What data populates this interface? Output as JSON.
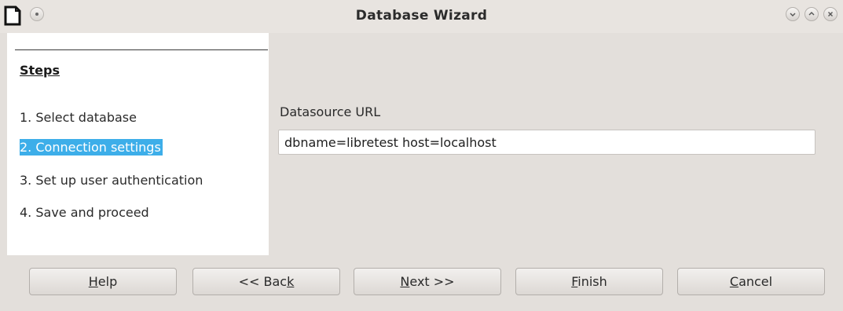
{
  "window": {
    "title": "Database Wizard",
    "app_icon": "document-icon",
    "controls": [
      "minimize-icon",
      "maximize-icon",
      "close-icon"
    ]
  },
  "steps": {
    "heading": "Steps",
    "items": [
      {
        "label": "1. Select database",
        "active": false
      },
      {
        "label": "2. Connection settings",
        "active": true
      },
      {
        "label": "3. Set up user authentication",
        "active": false
      },
      {
        "label": "4. Save and proceed",
        "active": false
      }
    ]
  },
  "form": {
    "datasource_label": "Datasource URL",
    "datasource_value": "dbname=libretest host=localhost"
  },
  "buttons": {
    "help": {
      "pre": "",
      "mnemonic": "H",
      "post": "elp"
    },
    "back": {
      "pre": "<< Bac",
      "mnemonic": "k",
      "post": ""
    },
    "next": {
      "pre": "",
      "mnemonic": "N",
      "post": "ext >>"
    },
    "finish": {
      "pre": "",
      "mnemonic": "F",
      "post": "inish"
    },
    "cancel": {
      "pre": "",
      "mnemonic": "C",
      "post": "ancel"
    }
  },
  "colors": {
    "highlight": "#3daee9",
    "window_bg": "#e3dfdb"
  }
}
